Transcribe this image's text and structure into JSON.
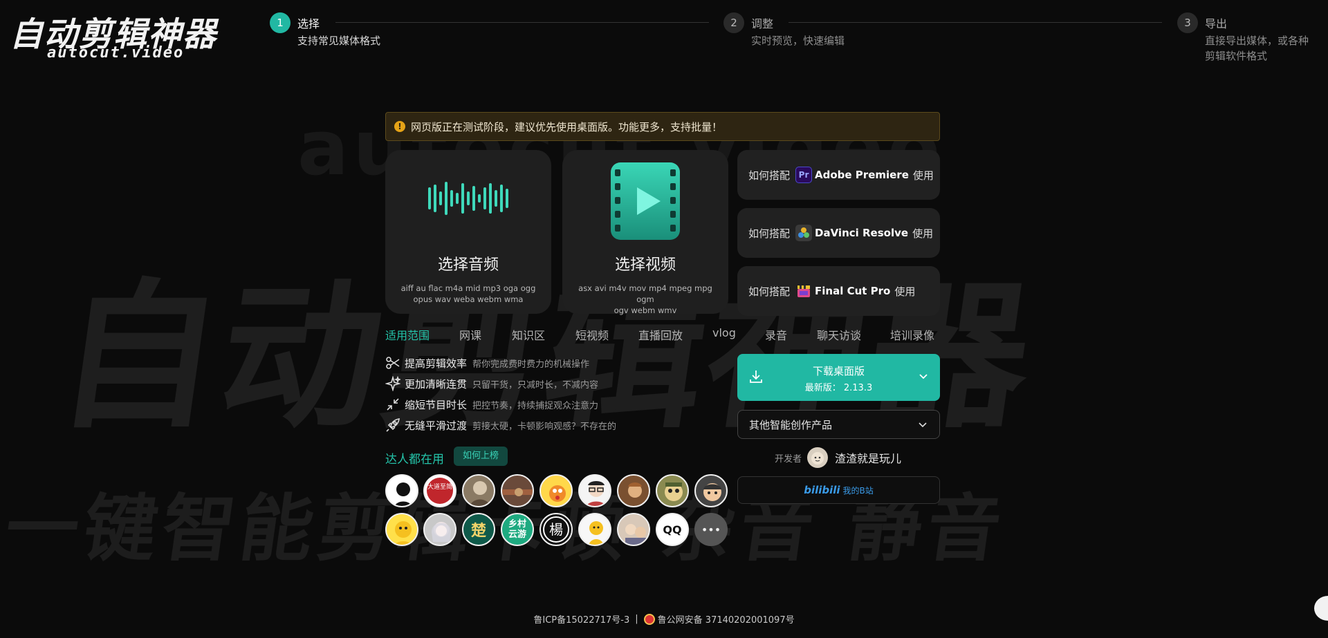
{
  "background": {
    "word_1": "autocut.video",
    "word_2": "自动剪辑神器",
    "word_3": "一键智能剪辑卡顿 杂音 静音"
  },
  "logo": {
    "title": "自动剪辑神器",
    "subtitle": "autocut.video"
  },
  "steps": [
    {
      "num": "1",
      "title": "选择",
      "desc": "支持常见媒体格式",
      "active": true
    },
    {
      "num": "2",
      "title": "调整",
      "desc": "实时预览，快速编辑",
      "active": false
    },
    {
      "num": "3",
      "title": "导出",
      "desc_line1": "直接导出媒体，或各种",
      "desc_line2": "剪辑软件格式",
      "active": false
    }
  ],
  "notice": {
    "icon": "!",
    "text": "网页版正在测试阶段，建议优先使用桌面版。功能更多，支持批量！"
  },
  "cards": {
    "audio": {
      "title": "选择音频",
      "formats_line1": "aiff au flac m4a mid mp3 oga ogg",
      "formats_line2": "opus wav weba webm wma",
      "icon": "audio-waveform-icon"
    },
    "video": {
      "title": "选择视频",
      "formats_line1": "asx avi m4v mov mp4 mpeg mpg ogm",
      "formats_line2": "ogv webm wmv",
      "icon": "video-film-play-icon"
    }
  },
  "guides": [
    {
      "pre": "如何搭配",
      "app_icon": "Pr",
      "app": "Adobe Premiere",
      "post": "使用"
    },
    {
      "pre": "如何搭配",
      "app_icon": "davinci-icon",
      "app": "DaVinci Resolve",
      "post": "使用"
    },
    {
      "pre": "如何搭配",
      "app_icon": "clapper-icon",
      "app": "Final Cut Pro",
      "post": "使用"
    }
  ],
  "scope": {
    "label": "适用范围",
    "items": [
      "网课",
      "知识区",
      "短视频",
      "直播回放",
      "vlog",
      "录音",
      "聊天访谈",
      "培训录像"
    ]
  },
  "features": [
    {
      "name": "提高剪辑效率",
      "desc": "帮你完成费时费力的机械操作",
      "icon": "scissors-icon"
    },
    {
      "name": "更加清晰连贯",
      "desc": "只留干货，只减时长，不减内容",
      "icon": "sparkle-icon"
    },
    {
      "name": "缩短节目时长",
      "desc": "把控节奏，持续捕捉观众注意力",
      "icon": "shrink-icon"
    },
    {
      "name": "无缝平滑过渡",
      "desc": "剪接太硬，卡顿影响观感？不存在的",
      "icon": "rocket-icon"
    }
  ],
  "experts": {
    "title": "达人都在用",
    "button": "如何上榜",
    "avatar_1_text": "大道至简",
    "avatar_19_text": "楚",
    "avatar_20_text": "乡村云游",
    "avatar_21_text": "楊",
    "avatar_24_text": "QQ",
    "more": "•••"
  },
  "download": {
    "title": "下载桌面版",
    "version": "最新版： 2.13.3"
  },
  "other_products": "其他智能创作产品",
  "developer": {
    "label": "开发者",
    "name": "渣渣就是玩儿"
  },
  "bilibili": {
    "logo": "bilibili",
    "text": "我的B站"
  },
  "footer": {
    "icp": "鲁ICP备15022717号-3",
    "separator": "|",
    "police": "鲁公网安备 37140202001097号"
  },
  "colors": {
    "accent": "#21b8a3",
    "accent_text": "#24c4aa",
    "background": "#0b0b0b",
    "card": "#1f1f1f",
    "notice_bg": "#2e2512",
    "bilibili": "#3a9be8"
  }
}
